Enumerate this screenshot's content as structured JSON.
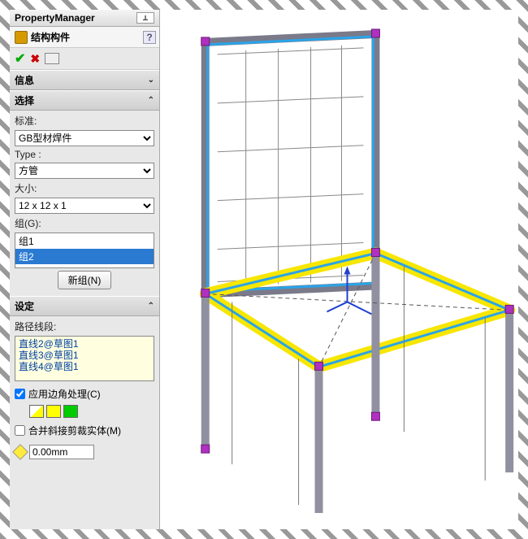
{
  "pm": {
    "title": "PropertyManager"
  },
  "feature": {
    "title": "结构构件",
    "help": "?"
  },
  "actions": {
    "ok": "✔",
    "cancel": "✖"
  },
  "sections": {
    "info": {
      "title": "信息"
    },
    "select": {
      "title": "选择",
      "standard_label": "标准:",
      "standard_value": "GB型材焊件",
      "type_label": "Type :",
      "type_value": "方管",
      "size_label": "大小:",
      "size_value": "12 x 12 x 1",
      "group_label": "组(G):",
      "groups": [
        "组1",
        "组2"
      ],
      "selected_group_index": 1,
      "new_group_btn": "新组(N)"
    },
    "settings": {
      "title": "设定",
      "path_label": "路径线段:",
      "paths": [
        "直线2@草图1",
        "直线3@草图1",
        "直线4@草图1"
      ],
      "corner_chk_label": "应用边角处理(C)",
      "corner_checked": true,
      "merge_chk_label": "合并斜接剪裁实体(M)",
      "merge_checked": false,
      "dim_value": "0.00mm"
    }
  }
}
